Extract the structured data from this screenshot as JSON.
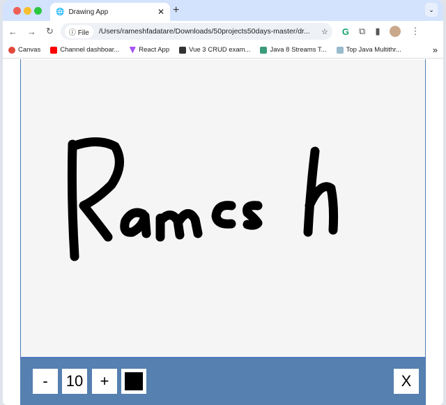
{
  "browser": {
    "tab_title": "Drawing App",
    "url_chip": "File",
    "url": "/Users/rameshfadatare/Downloads/50projects50days-master/dr...",
    "bookmarks": [
      "Canvas",
      "Channel dashboar...",
      "React App",
      "Vue 3 CRUD exam...",
      "Java 8 Streams T...",
      "Top Java Multithr..."
    ],
    "overflow": "»"
  },
  "app": {
    "drawing_text": "Ramesh",
    "decrease_label": "-",
    "size": "10",
    "increase_label": "+",
    "color": "#000000",
    "clear_label": "X",
    "canvas_bg": "#f5f5f5",
    "toolbox_color": "#5580b0"
  }
}
